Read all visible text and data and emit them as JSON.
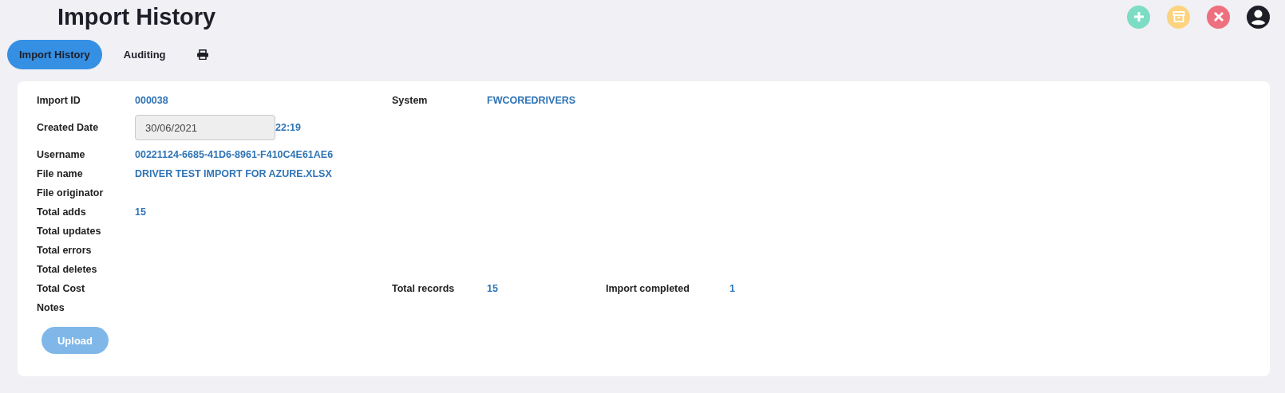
{
  "title": "Import History",
  "tabs": [
    {
      "label": "Import History",
      "selected": true
    },
    {
      "label": "Auditing",
      "selected": false
    }
  ],
  "rows": [
    {
      "cells": [
        {
          "label": "Import ID",
          "value": "000038"
        },
        {
          "label": "System",
          "value": "FWCOREDRIVERS"
        }
      ]
    },
    {
      "cells": [
        {
          "label": "Created Date",
          "kind": "date",
          "value": "30/06/2021",
          "time": "22:19"
        }
      ]
    },
    {
      "cells": [
        {
          "label": "Username",
          "value": "00221124-6685-41D6-8961-F410C4E61AE6"
        }
      ]
    },
    {
      "cells": [
        {
          "label": "File name",
          "value": "DRIVER TEST IMPORT FOR AZURE.XLSX"
        }
      ]
    },
    {
      "cells": [
        {
          "label": "File originator"
        }
      ]
    },
    {
      "cells": [
        {
          "label": "Total adds",
          "value": "15"
        }
      ]
    },
    {
      "cells": [
        {
          "label": "Total updates"
        }
      ]
    },
    {
      "cells": [
        {
          "label": "Total errors"
        }
      ]
    },
    {
      "cells": [
        {
          "label": "Total deletes"
        }
      ]
    },
    {
      "cells": [
        {
          "label": "Total Cost"
        },
        {
          "label": "Total records",
          "value": "15"
        },
        {
          "label": "Import completed",
          "value": "1"
        }
      ]
    },
    {
      "cells": [
        {
          "label": "Notes"
        }
      ]
    }
  ],
  "upload": {
    "label": "Upload",
    "disabled": true
  }
}
